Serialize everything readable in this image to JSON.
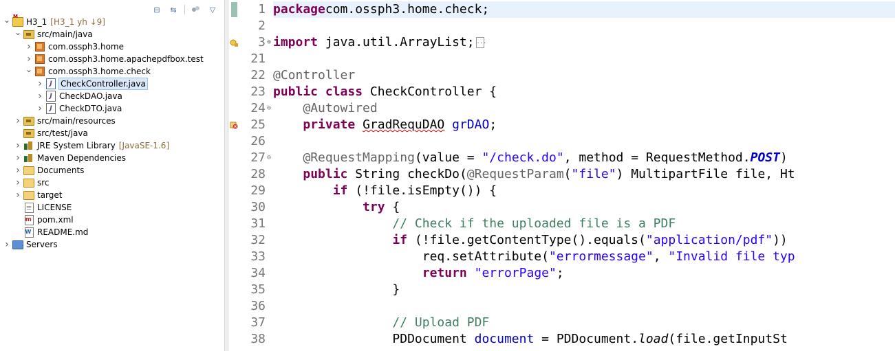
{
  "toolbar": {
    "collapse_all": "⊟",
    "link_editor": "⇆",
    "view_menu": "▽"
  },
  "tree": [
    {
      "id": "project",
      "depth": 0,
      "twisty": "expanded",
      "icon": "project-icon",
      "label": "H3_1",
      "deco": "[H3_1 yh ↓9]"
    },
    {
      "id": "src-main-java",
      "depth": 1,
      "twisty": "expanded",
      "icon": "source-folder-icon",
      "label": "src/main/java"
    },
    {
      "id": "pkg-home",
      "depth": 2,
      "twisty": "collapsed",
      "icon": "package-icon",
      "label": "com.ossph3.home"
    },
    {
      "id": "pkg-pdfbox",
      "depth": 2,
      "twisty": "collapsed",
      "icon": "package-icon",
      "label": "com.ossph3.home.apachepdfbox.test"
    },
    {
      "id": "pkg-check",
      "depth": 2,
      "twisty": "expanded",
      "icon": "package-icon",
      "label": "com.ossph3.home.check"
    },
    {
      "id": "file-checkcontroller",
      "depth": 3,
      "twisty": "collapsed",
      "icon": "java-file-icon",
      "label": "CheckController.java",
      "selected": true
    },
    {
      "id": "file-checkdao",
      "depth": 3,
      "twisty": "collapsed",
      "icon": "java-file-icon",
      "label": "CheckDAO.java"
    },
    {
      "id": "file-checkdto",
      "depth": 3,
      "twisty": "collapsed",
      "icon": "java-file-icon",
      "label": "CheckDTO.java"
    },
    {
      "id": "src-main-resources",
      "depth": 1,
      "twisty": "collapsed",
      "icon": "source-folder-icon",
      "label": "src/main/resources"
    },
    {
      "id": "src-test-java",
      "depth": 1,
      "twisty": "none",
      "icon": "source-folder-icon",
      "label": "src/test/java"
    },
    {
      "id": "jre",
      "depth": 1,
      "twisty": "collapsed",
      "icon": "library-icon",
      "label": "JRE System Library",
      "deco": "[JavaSE-1.6]"
    },
    {
      "id": "maven",
      "depth": 1,
      "twisty": "collapsed",
      "icon": "library-icon",
      "label": "Maven Dependencies"
    },
    {
      "id": "documents",
      "depth": 1,
      "twisty": "collapsed",
      "icon": "folder-icon",
      "label": "Documents"
    },
    {
      "id": "src",
      "depth": 1,
      "twisty": "collapsed",
      "icon": "folder-icon",
      "label": "src"
    },
    {
      "id": "target",
      "depth": 1,
      "twisty": "collapsed",
      "icon": "folder-icon",
      "label": "target"
    },
    {
      "id": "license",
      "depth": 1,
      "twisty": "none",
      "icon": "file-icon",
      "label": "LICENSE"
    },
    {
      "id": "pom",
      "depth": 1,
      "twisty": "none",
      "icon": "xml-file-icon",
      "label": "pom.xml"
    },
    {
      "id": "readme",
      "depth": 1,
      "twisty": "none",
      "icon": "md-file-icon",
      "label": "README.md"
    },
    {
      "id": "servers",
      "depth": 0,
      "twisty": "collapsed",
      "icon": "servers-icon",
      "label": "Servers"
    }
  ],
  "editor": {
    "lines": [
      {
        "num": "1",
        "current": true,
        "tokens": [
          [
            "kw",
            "package"
          ],
          [
            "",
            "com.ossph3.home.check;"
          ]
        ]
      },
      {
        "num": "2",
        "tokens": []
      },
      {
        "num": "3",
        "fold": "⊕",
        "marker": "warning-icon",
        "tokens": [
          [
            "kw",
            "import"
          ],
          [
            "",
            " java.util.ArrayList;"
          ],
          [
            "box",
            ""
          ]
        ]
      },
      {
        "num": "21",
        "tokens": []
      },
      {
        "num": "22",
        "tokens": [
          [
            "ann",
            "@Controller"
          ]
        ]
      },
      {
        "num": "23",
        "tokens": [
          [
            "kw",
            "public"
          ],
          [
            "",
            " "
          ],
          [
            "kw",
            "class"
          ],
          [
            "",
            " CheckController {"
          ]
        ]
      },
      {
        "num": "24",
        "fold": "⊖",
        "tokens": [
          [
            "",
            "    "
          ],
          [
            "ann",
            "@Autowired"
          ]
        ]
      },
      {
        "num": "25",
        "marker": "error-icon",
        "tokens": [
          [
            "",
            "    "
          ],
          [
            "kw",
            "private"
          ],
          [
            "",
            " "
          ],
          [
            "err",
            "GradRequDAO"
          ],
          [
            "",
            " "
          ],
          [
            "field",
            "grDAO"
          ],
          [
            "",
            ";"
          ]
        ]
      },
      {
        "num": "26",
        "tokens": []
      },
      {
        "num": "27",
        "fold": "⊖",
        "tokens": [
          [
            "",
            "    "
          ],
          [
            "ann",
            "@RequestMapping"
          ],
          [
            "",
            "(value = "
          ],
          [
            "str",
            "\"/check.do\""
          ],
          [
            "",
            ", method = RequestMethod."
          ],
          [
            "staticconst",
            "POST"
          ],
          [
            "",
            ")"
          ]
        ]
      },
      {
        "num": "28",
        "tokens": [
          [
            "",
            "    "
          ],
          [
            "kw",
            "public"
          ],
          [
            "",
            " String checkDo("
          ],
          [
            "ann",
            "@RequestParam"
          ],
          [
            "",
            "("
          ],
          [
            "str",
            "\"file\""
          ],
          [
            "",
            ") MultipartFile file, Ht"
          ]
        ]
      },
      {
        "num": "29",
        "tokens": [
          [
            "",
            "        "
          ],
          [
            "kw",
            "if"
          ],
          [
            "",
            " (!file.isEmpty()) {"
          ]
        ]
      },
      {
        "num": "30",
        "tokens": [
          [
            "",
            "            "
          ],
          [
            "kw",
            "try"
          ],
          [
            "",
            " {"
          ]
        ]
      },
      {
        "num": "31",
        "tokens": [
          [
            "",
            "                "
          ],
          [
            "cmt",
            "// Check if the uploaded file is a PDF"
          ]
        ]
      },
      {
        "num": "32",
        "tokens": [
          [
            "",
            "                "
          ],
          [
            "kw",
            "if"
          ],
          [
            "",
            " (!file.getContentType().equals("
          ],
          [
            "str",
            "\"application/pdf\""
          ],
          [
            "",
            "))"
          ]
        ]
      },
      {
        "num": "33",
        "tokens": [
          [
            "",
            "                    req.setAttribute("
          ],
          [
            "str",
            "\"errormessage\""
          ],
          [
            "",
            ", "
          ],
          [
            "str",
            "\"Invalid file typ"
          ]
        ]
      },
      {
        "num": "34",
        "tokens": [
          [
            "",
            "                    "
          ],
          [
            "kw",
            "return"
          ],
          [
            "",
            " "
          ],
          [
            "str",
            "\"errorPage\""
          ],
          [
            "",
            ";"
          ]
        ]
      },
      {
        "num": "35",
        "tokens": [
          [
            "",
            "                }"
          ]
        ]
      },
      {
        "num": "36",
        "tokens": []
      },
      {
        "num": "37",
        "tokens": [
          [
            "",
            "                "
          ],
          [
            "cmt",
            "// Upload PDF"
          ]
        ]
      },
      {
        "num": "38",
        "tokens": [
          [
            "",
            "                PDDocument "
          ],
          [
            "field",
            "document"
          ],
          [
            "",
            " = PDDocument."
          ],
          [
            "staticm",
            "load"
          ],
          [
            "",
            "(file.getInputSt"
          ]
        ]
      }
    ]
  },
  "colors": {
    "keyword": "#7f0055",
    "string": "#2a00ff",
    "annotation": "#646464",
    "comment": "#3f7f5f",
    "field": "#0000c0",
    "current_line": "#e8f2fe",
    "selection": "#d9e8fb"
  }
}
